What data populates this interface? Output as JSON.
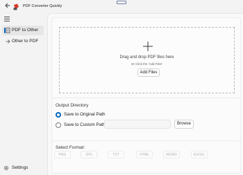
{
  "app": {
    "title": "PDF Converter Quickly",
    "icons": {
      "back": "back-arrow-icon",
      "app": "pdf-converter-icon",
      "menu": "hamburger-icon"
    }
  },
  "sidebar": {
    "items": [
      {
        "label": "PDF to Other",
        "icon": "pdf-doc-icon",
        "active": true
      },
      {
        "label": "Other to PDF",
        "icon": "arrow-right-icon",
        "active": false
      }
    ],
    "settings_label": "Settings"
  },
  "drop": {
    "main_text": "Drag and drop PDF files here",
    "sub_text": "Or Click the 'Add Files'",
    "add_button": "Add Files"
  },
  "output": {
    "title": "Output Directory",
    "original_label": "Save to Original Path",
    "custom_label": "Save to Custom Path",
    "path_value": "",
    "browse_label": "Browse",
    "selected": "original"
  },
  "format": {
    "title": "Select Format:",
    "options": [
      "PNG",
      "JPG",
      "TXT",
      "HTML",
      "WORD",
      "EXCEL"
    ]
  },
  "colors": {
    "accent": "#0067c0",
    "pdf_red": "#d9342b"
  }
}
